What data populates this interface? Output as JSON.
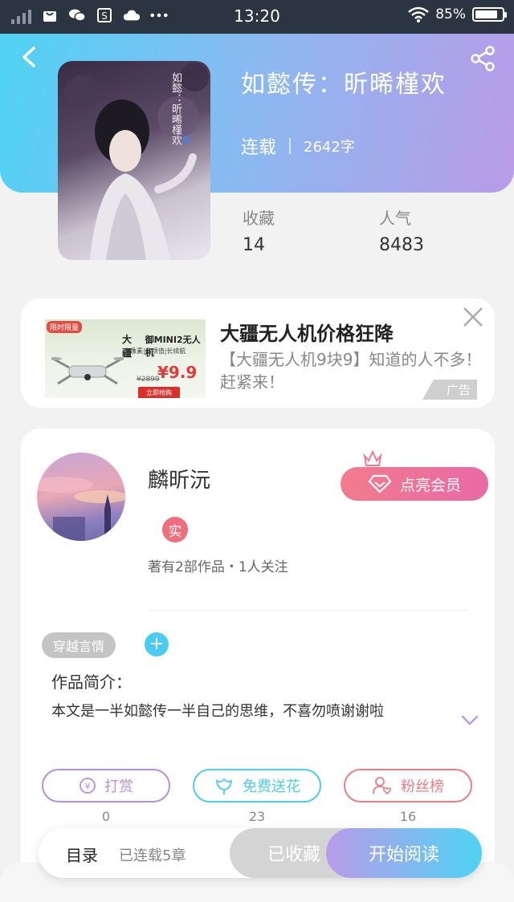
{
  "status_bar": {
    "time": "13:20",
    "battery_text": "85%",
    "battery_level": 0.85,
    "notification_icons": [
      "signal-icon",
      "notification-bag-icon",
      "wechat-icon",
      "s-app-icon",
      "cloud-icon",
      "more-dots-icon"
    ]
  },
  "book": {
    "title": "如懿传：昕晞槿欢",
    "status": "连载",
    "word_count": "2642字",
    "cover_text": "如懿：昕晞槿欢",
    "stats": [
      {
        "label": "收藏",
        "value": "14"
      },
      {
        "label": "人气",
        "value": "8483"
      }
    ]
  },
  "ad": {
    "title": "大疆无人机价格狂降",
    "description": "【大疆无人机9块9】知道的人不多！赶紧来！",
    "tag": "广告",
    "image": {
      "badge": "限时限量",
      "brand": "大疆",
      "model": "御MINI2无人机",
      "features": "高像素|高颜值|长续航",
      "old_price": "¥2899",
      "price": "¥9.9",
      "cta": "立即抢购"
    }
  },
  "author": {
    "name": "麟昕沅",
    "badge": "实",
    "info": "著有2部作品・1人关注",
    "vip_button": "点亮会员"
  },
  "work": {
    "tag": "穿越言情",
    "add_tag": "+",
    "intro_title": "作品简介：",
    "intro_text": "本文是一半如懿传一半自己的思维，不喜勿喷谢谢啦"
  },
  "actions": [
    {
      "label": "打赏",
      "count": "0",
      "color": "#b88ee0"
    },
    {
      "label": "免费送花",
      "count": "23",
      "color": "#4ccbf2"
    },
    {
      "label": "粉丝榜",
      "count": "16",
      "color": "#ee7b85"
    }
  ],
  "bottom_bar": {
    "toc": "目录",
    "chapters": "已连载5章",
    "collected": "已收藏",
    "read": "开始阅读"
  }
}
